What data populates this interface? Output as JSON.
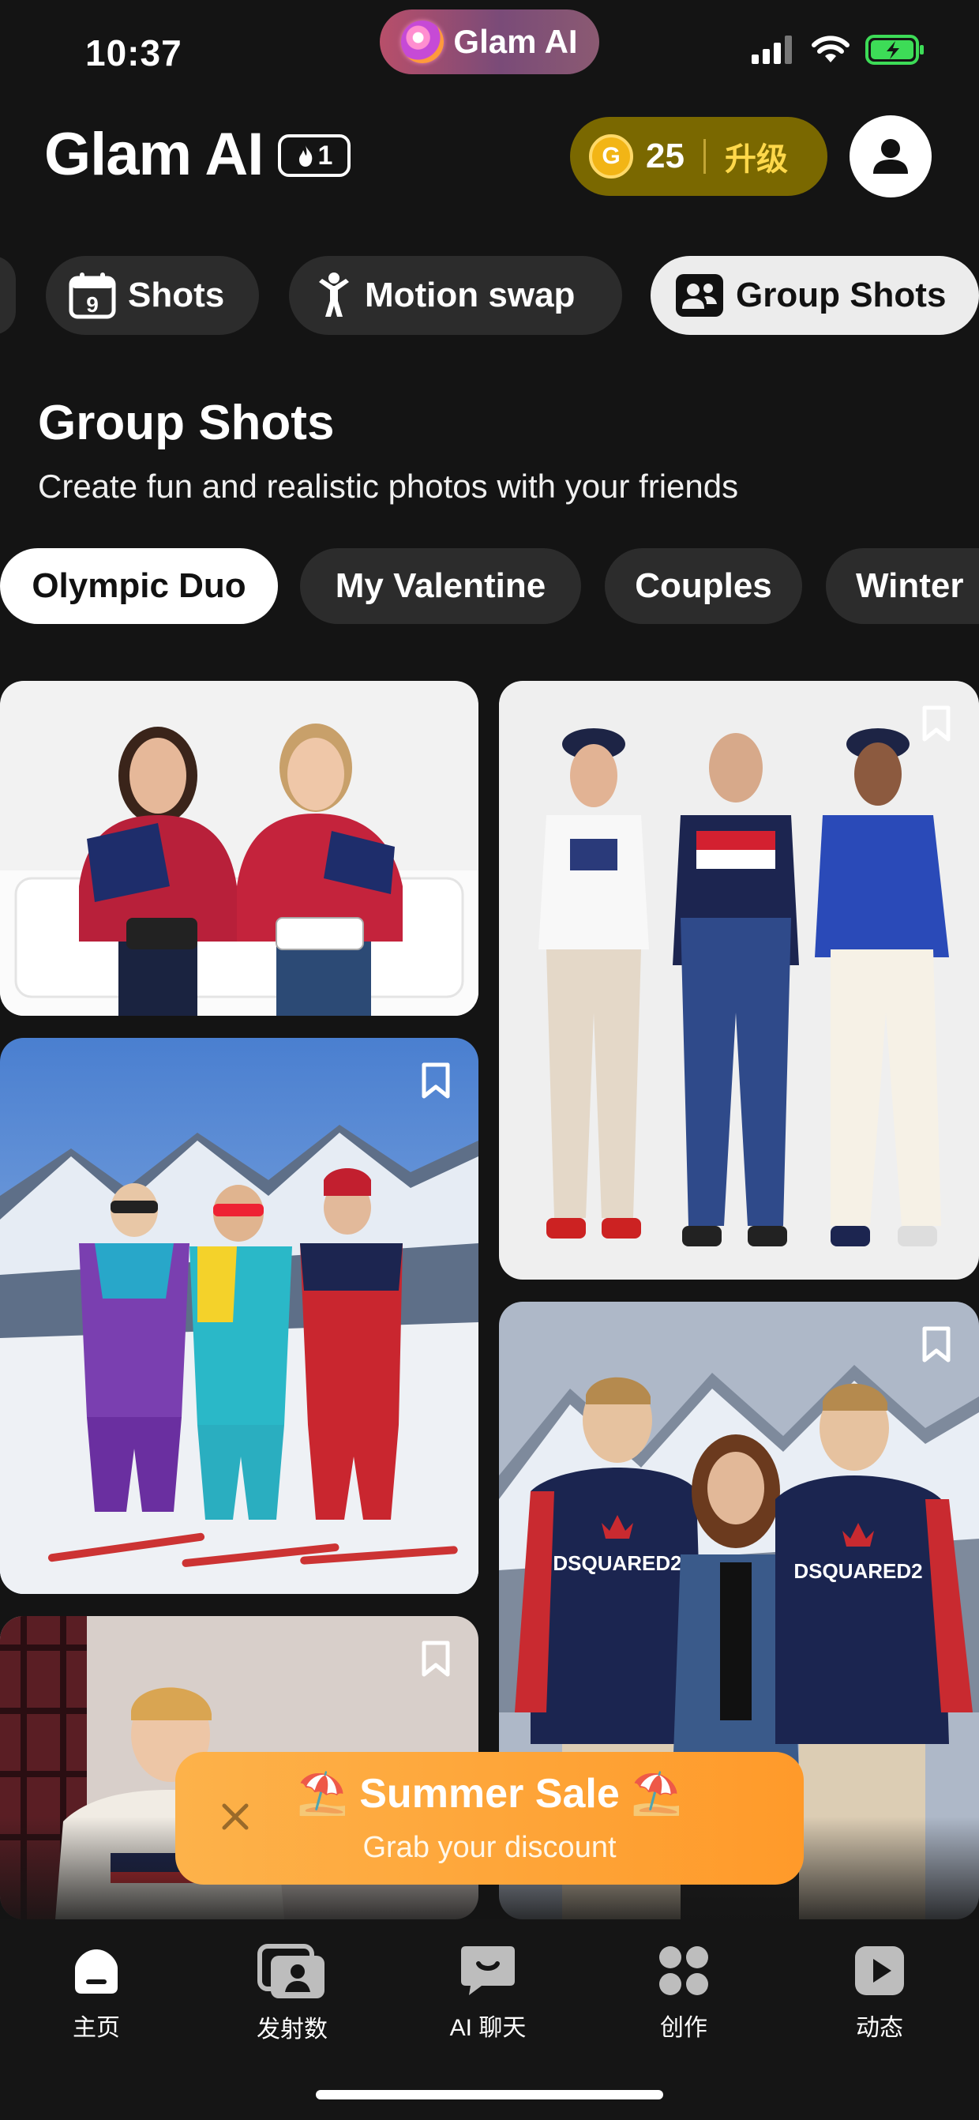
{
  "status": {
    "time": "10:37",
    "island_label": "Glam AI"
  },
  "header": {
    "brand": "Glam AI",
    "streak": "1",
    "coins": "25",
    "upgrade": "升级"
  },
  "feature_tabs": [
    {
      "label": "Shots",
      "icon": "calendar-icon",
      "badge": "9"
    },
    {
      "label": "Motion swap",
      "icon": "person-icon"
    },
    {
      "label": "Group Shots",
      "icon": "group-icon",
      "active": true
    }
  ],
  "section": {
    "title": "Group Shots",
    "subtitle": "Create fun and realistic photos with your friends"
  },
  "chips": [
    {
      "label": "Olympic Duo",
      "active": true
    },
    {
      "label": "My Valentine"
    },
    {
      "label": "Couples"
    },
    {
      "label": "Winter"
    }
  ],
  "banner": {
    "title": "Summer Sale",
    "subtitle": "Grab your discount",
    "emoji": "⛱️"
  },
  "cards": [
    {
      "text": ""
    },
    {
      "text": "DSQUARED2"
    }
  ],
  "nav": [
    {
      "label": "主页",
      "icon": "home-icon",
      "active": true
    },
    {
      "label": "发射数",
      "icon": "gallery-icon"
    },
    {
      "label": "AI 聊天",
      "icon": "chat-icon"
    },
    {
      "label": "创作",
      "icon": "create-icon"
    },
    {
      "label": "动态",
      "icon": "play-icon"
    }
  ],
  "colors": {
    "accent_gold": "#ffd84a",
    "coin_pill": "#7a6800",
    "banner": "#fdb24a",
    "bg": "#141414"
  }
}
